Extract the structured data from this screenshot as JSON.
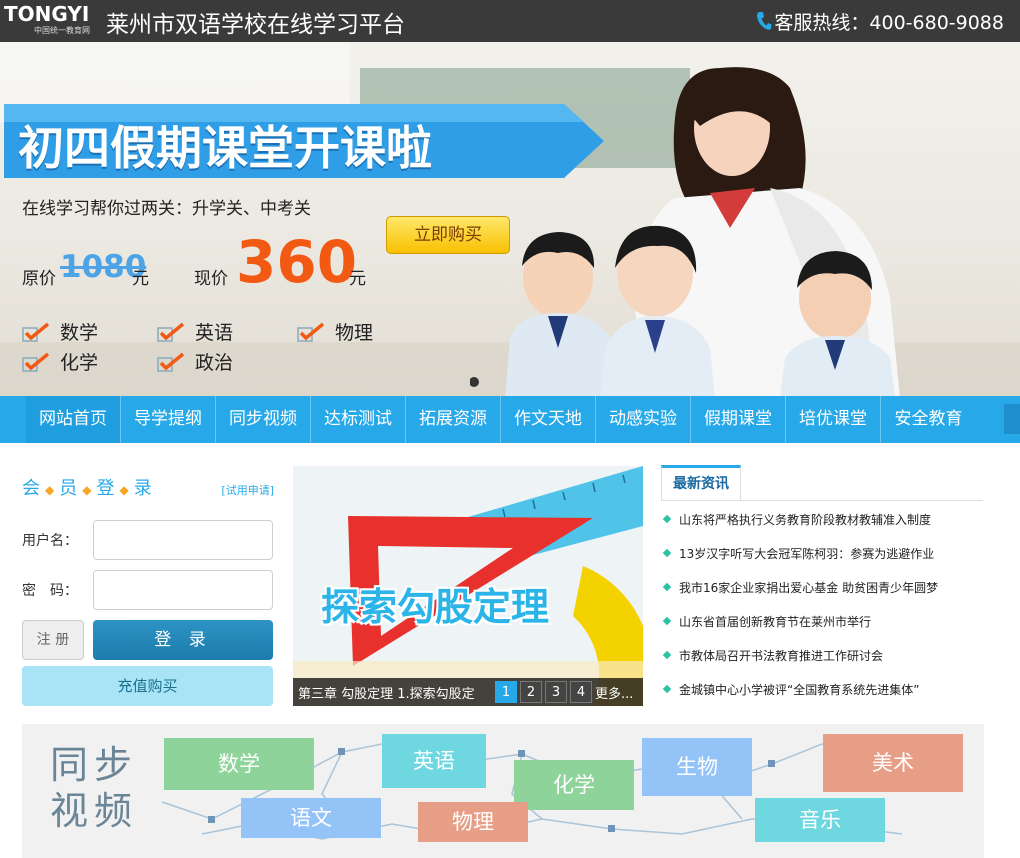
{
  "header": {
    "logo_text": "TONGYI",
    "logo_sub": "中国统一教育网",
    "site_title": "莱州市双语学校在线学习平台",
    "hotline": "客服热线：400-680-9088"
  },
  "banner": {
    "headline": "初四假期课堂开课啦",
    "subline": "在线学习帮你过两关：升学关、中考关",
    "buy_label": "立即购买",
    "orig_label": "原价",
    "orig_price": "1080",
    "orig_unit": "元",
    "now_label": "现价",
    "now_price": "360",
    "now_unit": "元",
    "subjects": [
      "数学",
      "英语",
      "物理",
      "化学",
      "政治"
    ]
  },
  "nav": {
    "items": [
      "网站首页",
      "导学提纲",
      "同步视频",
      "达标测试",
      "拓展资源",
      "作文天地",
      "动感实验",
      "假期课堂",
      "培优课堂",
      "安全教育"
    ]
  },
  "login": {
    "title_chars": [
      "会",
      "员",
      "登",
      "录"
    ],
    "trial_link": "[试用申请]",
    "username_label": "用户名：",
    "password_label": "密　码：",
    "register_label": "注 册",
    "login_label": "登 录",
    "recharge_label": "充值购买"
  },
  "slider": {
    "image_title": "探索勾股定理",
    "caption": "第三章 勾股定理 1.探索勾股定",
    "pages": [
      "1",
      "2",
      "3",
      "4"
    ],
    "more": "更多..."
  },
  "news": {
    "tab": "最新资讯",
    "items": [
      "山东将严格执行义务教育阶段教材教辅准入制度",
      "13岁汉字听写大会冠军陈柯羽：参赛为逃避作业",
      "我市16家企业家捐出爱心基金 助贫困青少年圆梦",
      "山东省首届创新教育节在莱州市举行",
      "市教体局召开书法教育推进工作研讨会",
      "金城镇中心小学被评“全国教育系统先进集体”"
    ]
  },
  "sync": {
    "title": "同步视频",
    "subjects": [
      "数学",
      "英语",
      "化学",
      "生物",
      "美术",
      "语文",
      "物理",
      "音乐"
    ]
  },
  "colors": {
    "accent": "#27a9e9",
    "topbar": "#3a3a3a",
    "price_orange": "#f25a13"
  }
}
